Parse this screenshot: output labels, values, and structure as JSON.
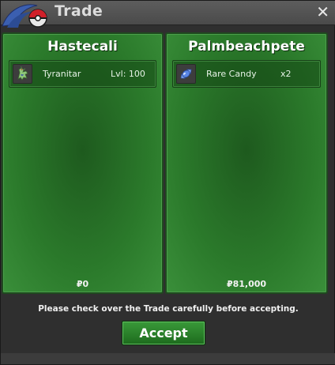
{
  "window": {
    "title": "Trade",
    "close_label": "✕"
  },
  "left_panel": {
    "trainer": "Hastecali",
    "item": {
      "name": "Tyranitar",
      "extra": "Lvl: 100",
      "icon": "tyranitar-pokemon-icon"
    },
    "money_symbol": "₽",
    "money": "0"
  },
  "right_panel": {
    "trainer": "Palmbeachpete",
    "item": {
      "name": "Rare Candy",
      "extra": "x2",
      "icon": "rare-candy-icon"
    },
    "money_symbol": "₽",
    "money": "81,000"
  },
  "footer": {
    "notice": "Please check over the Trade carefully before accepting.",
    "accept_label": "Accept"
  },
  "colors": {
    "panel_green": "#2b7a2b",
    "button_green": "#2a842a",
    "titlebar": "#555555"
  }
}
